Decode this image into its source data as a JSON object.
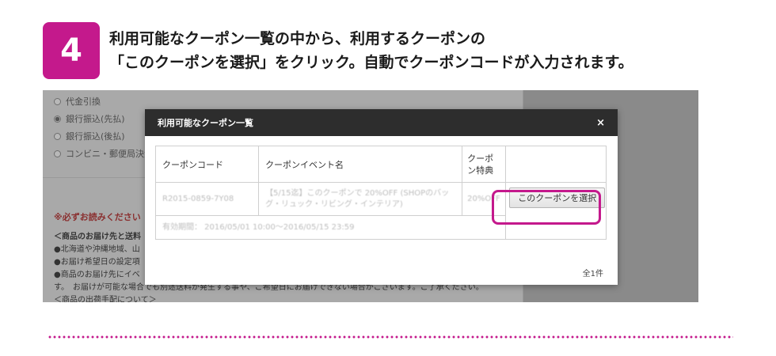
{
  "step": {
    "number": "4",
    "line1": "利用可能なクーポン一覧の中から、利用するクーポンの",
    "line2": "「このクーポンを選択」をクリック。自動でクーポンコードが入力されます。"
  },
  "background": {
    "payment_options": [
      {
        "label": "代金引換",
        "selected": false
      },
      {
        "label": "銀行振込(先払)",
        "selected": true
      },
      {
        "label": "銀行振込(後払)",
        "selected": false
      },
      {
        "label": "コンビニ・郵便局決済",
        "selected": false
      }
    ],
    "warning_title": "※必ずお読みください",
    "lines": [
      "＜商品のお届け先と送料",
      "●北海道や沖縄地域、山",
      "●お届け希望日の設定項",
      "●商品のお届け先にイベ",
      "す。　お届けが可能な場合でも別途送料が発生する事や、ご希望日にお届けできない場合がございます。ご了承ください。",
      "＜商品の出荷手配について＞"
    ]
  },
  "modal": {
    "title": "利用可能なクーポン一覧",
    "close": "×",
    "columns": [
      "クーポンコード",
      "クーポンイベント名",
      "クーポン特典"
    ],
    "rows": [
      {
        "code": "R2015-0859-7Y08",
        "event_name": "【5/15迄】このクーポンで 20%OFF (SHOPのバッグ・リュック・リビング・インテリア)",
        "benefit": "20%OFF",
        "period": "有効期間： 2016/05/01 10:00〜2016/05/15 23:59",
        "button": "このクーポンを選択"
      }
    ],
    "count": "全1件"
  },
  "colors": {
    "accent": "#c4198c",
    "modal_header": "#2d2d2d"
  }
}
